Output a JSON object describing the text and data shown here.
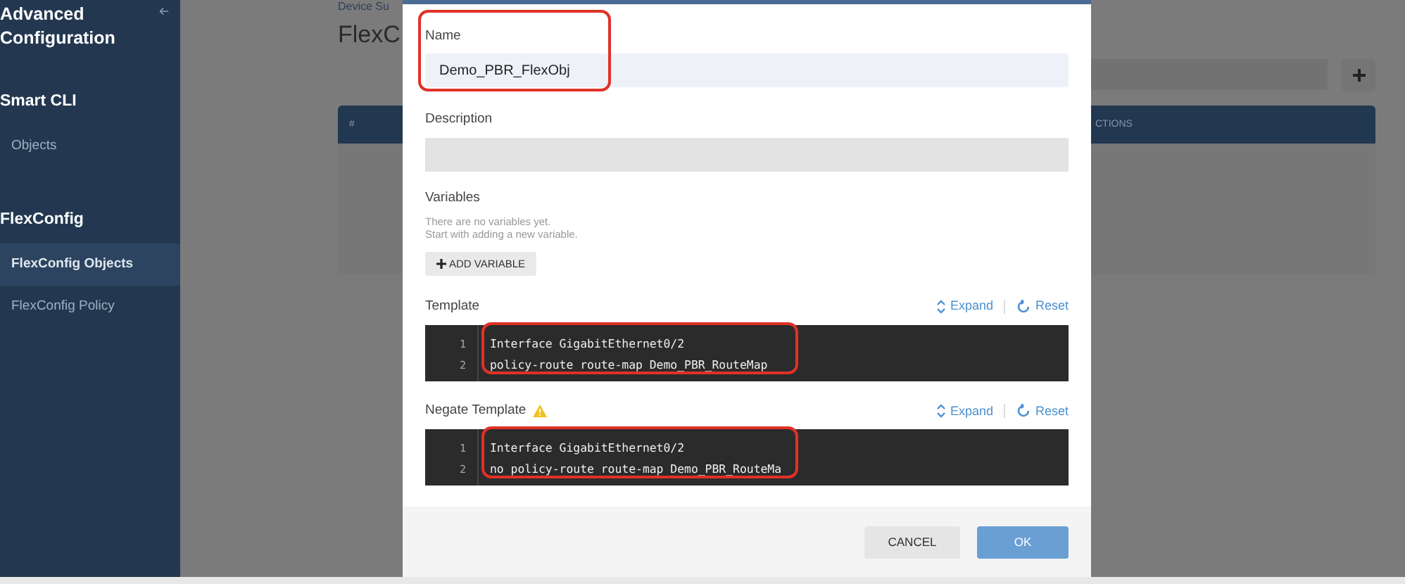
{
  "sidebar": {
    "title": "Advanced Configuration",
    "sections": [
      {
        "heading": "Smart CLI",
        "items": [
          {
            "label": "Objects",
            "selected": false
          }
        ]
      },
      {
        "heading": "FlexConfig",
        "items": [
          {
            "label": "FlexConfig Objects",
            "selected": true
          },
          {
            "label": "FlexConfig Policy",
            "selected": false
          }
        ]
      }
    ]
  },
  "background_page": {
    "breadcrumb": "Device Su",
    "title": "FlexC",
    "table": {
      "columns": [
        "#",
        "CTIONS"
      ]
    }
  },
  "dialog": {
    "name": {
      "label": "Name",
      "value": "Demo_PBR_FlexObj",
      "highlighted": true
    },
    "description": {
      "label": "Description"
    },
    "variables": {
      "label": "Variables",
      "hint": [
        "There are no variables yet.",
        "Start with adding a new variable."
      ],
      "add_button": "ADD VARIABLE"
    },
    "templates": [
      {
        "label": "Template",
        "warning": false,
        "highlighted": true,
        "actions": [
          "Expand",
          "Reset"
        ],
        "lines": [
          {
            "number": "1",
            "text": "Interface GigabitEthernet0/2"
          },
          {
            "number": "2",
            "text": "policy-route route-map Demo_PBR_RouteMap"
          }
        ]
      },
      {
        "label": "Negate Template",
        "warning": true,
        "highlighted": true,
        "actions": [
          "Expand",
          "Reset"
        ],
        "lines": [
          {
            "number": "1",
            "text": "Interface GigabitEthernet0/2"
          },
          {
            "number": "2",
            "text": "no policy-route route-map Demo_PBR_RouteMa"
          }
        ]
      }
    ],
    "buttons": [
      {
        "label": "CANCEL",
        "kind": "secondary"
      },
      {
        "label": "OK",
        "kind": "primary"
      }
    ]
  }
}
